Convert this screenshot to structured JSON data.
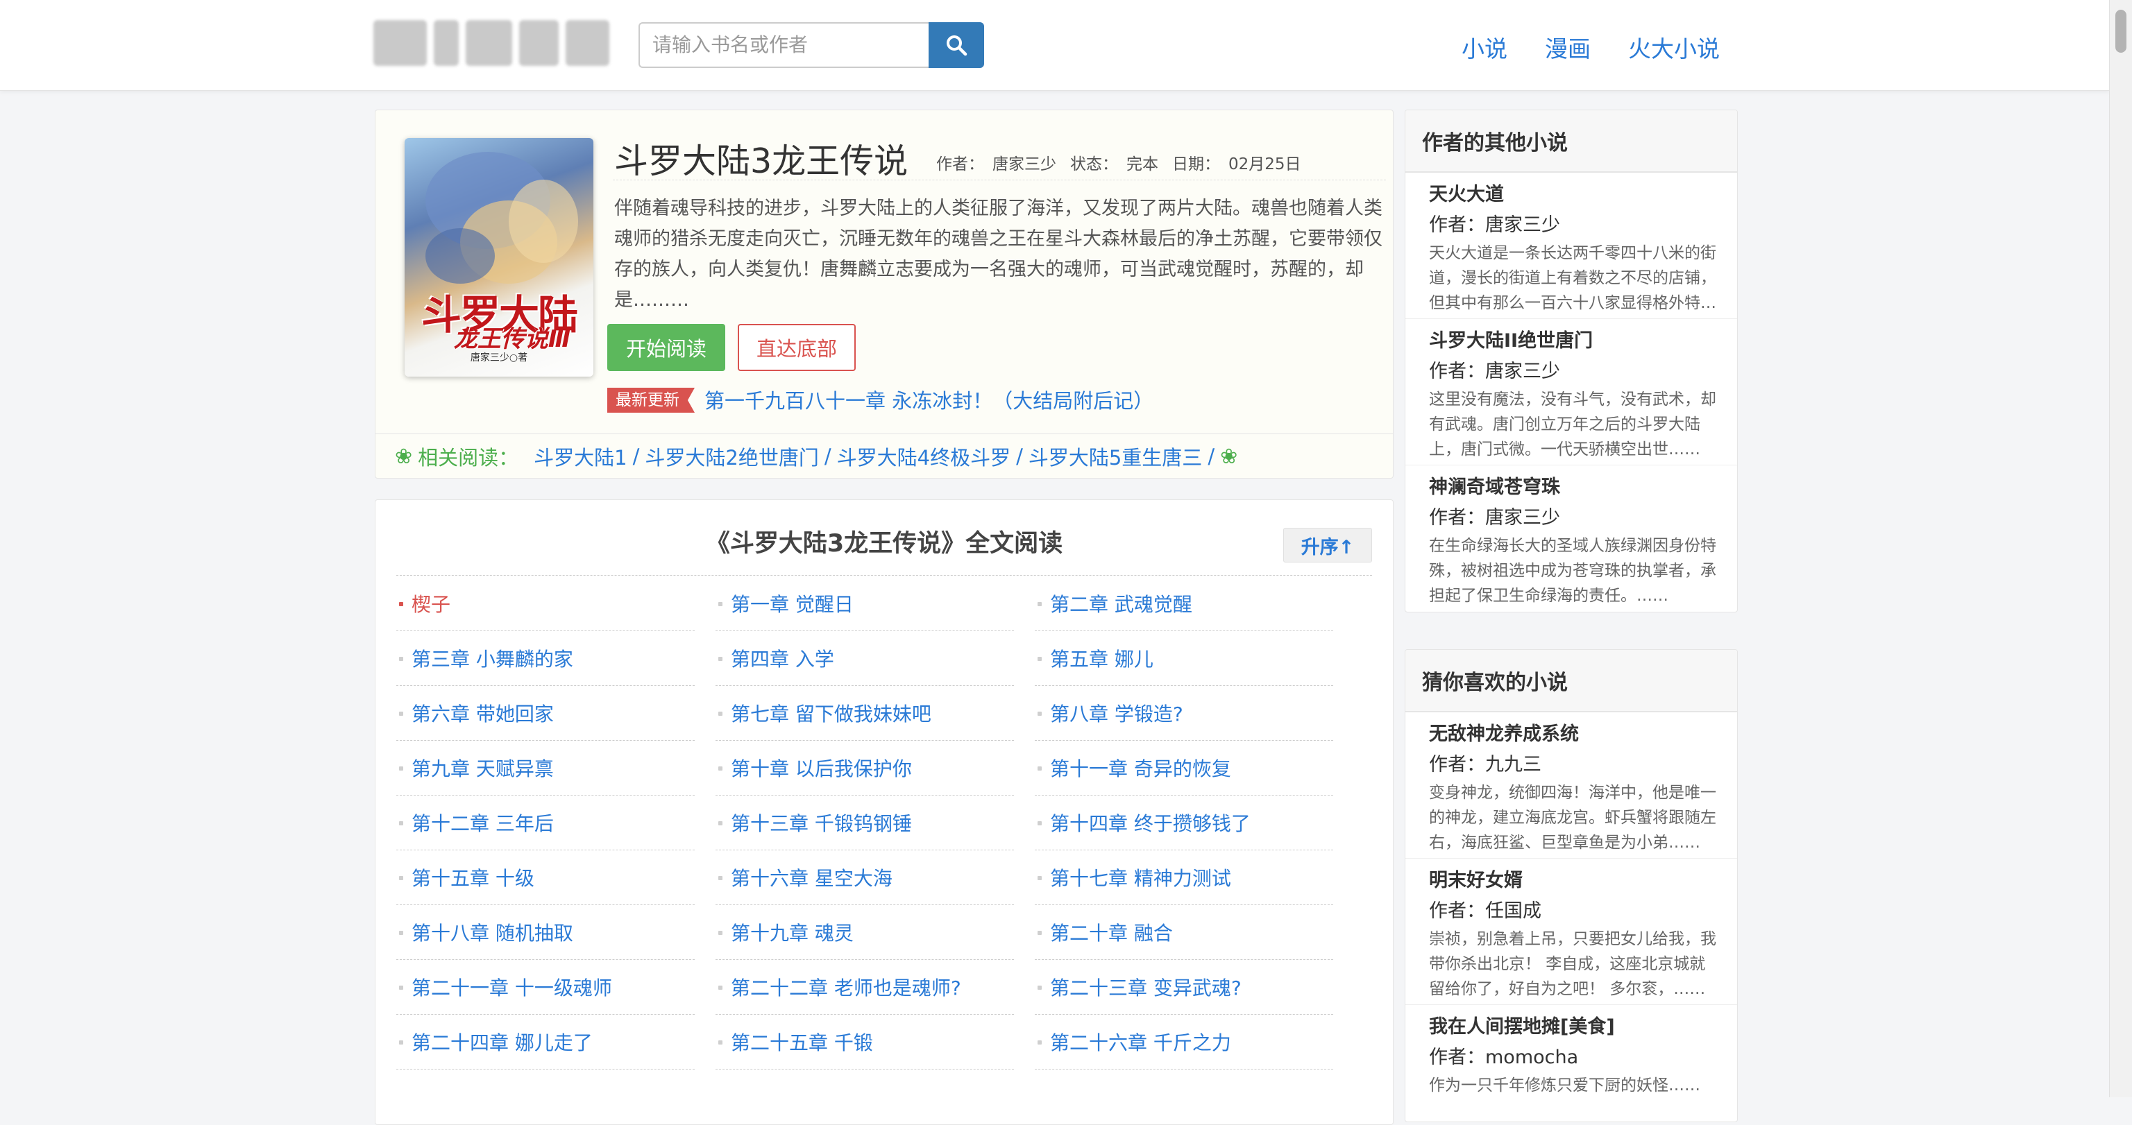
{
  "header": {
    "search": {
      "placeholder": "请输入书名或作者"
    },
    "nav": [
      "小说",
      "漫画",
      "火大小说"
    ]
  },
  "book": {
    "title": "斗罗大陆3龙王传说",
    "author_label": "作者：",
    "author": "唐家三少",
    "status_label": "状态：",
    "status": "完本",
    "date_label": "日期：",
    "date": "02月25日",
    "description": "伴随着魂导科技的进步，斗罗大陆上的人类征服了海洋，又发现了两片大陆。魂兽也随着人类魂师的猎杀无度走向灭亡，沉睡无数年的魂兽之王在星斗大森林最后的净土苏醒，它要带领仅存的族人，向人类复仇！唐舞麟立志要成为一名强大的魂师，可当武魂觉醒时，苏醒的，却是………",
    "cover": {
      "title_line1": "斗罗大陆",
      "title_line2": "龙王传说Ⅲ",
      "author_line": "唐家三少○著"
    },
    "start_button": "开始阅读",
    "bottom_button": "直达底部",
    "latest_label": "最新更新",
    "latest_chapter": "第一千九百八十一章 永冻冰封！（大结局附后记）",
    "related_label": "相关阅读：",
    "related": [
      "斗罗大陆1",
      "斗罗大陆2绝世唐门",
      "斗罗大陆4终极斗罗",
      "斗罗大陆5重生唐三"
    ]
  },
  "chapters": {
    "title": "《斗罗大陆3龙王传说》全文阅读",
    "sort_button": "升序↑",
    "items": [
      "楔子",
      "第一章 觉醒日",
      "第二章 武魂觉醒",
      "第三章 小舞麟的家",
      "第四章 入学",
      "第五章 娜儿",
      "第六章 带她回家",
      "第七章 留下做我妹妹吧",
      "第八章 学锻造?",
      "第九章 天赋异禀",
      "第十章 以后我保护你",
      "第十一章 奇异的恢复",
      "第十二章 三年后",
      "第十三章 千锻钨钢锤",
      "第十四章 终于攒够钱了",
      "第十五章 十级",
      "第十六章 星空大海",
      "第十七章 精神力测试",
      "第十八章 随机抽取",
      "第十九章 魂灵",
      "第二十章 融合",
      "第二十一章 十一级魂师",
      "第二十二章 老师也是魂师?",
      "第二十三章 变异武魂?",
      "第二十四章 娜儿走了",
      "第二十五章 千锻",
      "第二十六章 千斤之力"
    ]
  },
  "sidebar": {
    "other_title": "作者的其他小说",
    "other": [
      {
        "title": "天火大道",
        "author": "作者：唐家三少",
        "desc": "天火大道是一条长达两千零四十八米的街道，漫长的街道上有着数之不尽的店铺，但其中有那么一百六十八家显得格外特殊……"
      },
      {
        "title": "斗罗大陆II绝世唐门",
        "author": "作者：唐家三少",
        "desc": "这里没有魔法，没有斗气，没有武术，却有武魂。唐门创立万年之后的斗罗大陆上，唐门式微。一代天骄横空出世……"
      },
      {
        "title": "神澜奇域苍穹珠",
        "author": "作者：唐家三少",
        "desc": "在生命绿海长大的圣域人族绿渊因身份特殊，被树祖选中成为苍穹珠的执掌者，承担起了保卫生命绿海的责任。……"
      }
    ],
    "guess_title": "猜你喜欢的小说",
    "guess": [
      {
        "title": "无敌神龙养成系统",
        "author": "作者：九九三",
        "desc": "变身神龙，统御四海！海洋中，他是唯一的神龙，建立海底龙宫。虾兵蟹将跟随左右，海底狂鲨、巨型章鱼是为小弟……"
      },
      {
        "title": "明末好女婿",
        "author": "作者：任国成",
        "desc": "崇祯，别急着上吊，只要把女儿给我，我带你杀出北京！ 李自成，这座北京城就留给你了，好自为之吧！ 多尔衮，……"
      },
      {
        "title": "我在人间摆地摊[美食]",
        "author": "作者：momocha",
        "desc": "作为一只千年修炼只爱下厨的妖怪……"
      }
    ]
  },
  "colors": {
    "link": "#2a7ad6",
    "green": "#5cb85c",
    "red": "#d9534f",
    "search_button": "#337ab7"
  }
}
